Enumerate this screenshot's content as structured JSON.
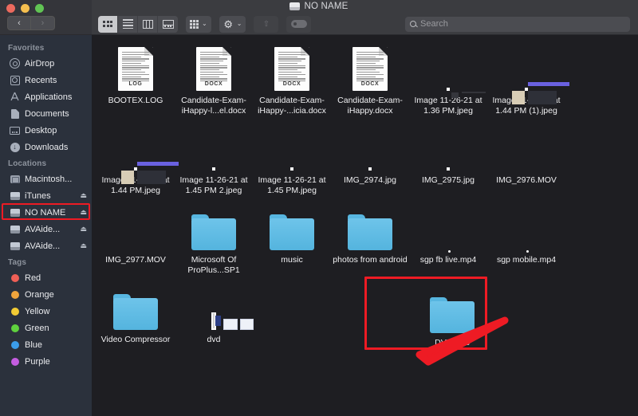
{
  "window": {
    "title": "NO NAME",
    "traffic_lights": [
      "close",
      "minimize",
      "maximize"
    ]
  },
  "toolbar": {
    "back_label": "‹",
    "forward_label": "›",
    "view_icon": "icon-view",
    "list_view": "list-view",
    "column_view": "column-view",
    "gallery_view": "gallery-view",
    "arrange_label": "arrange-button",
    "action_label": "action-gear-button",
    "share_label": "share-button",
    "tags_label": "tags-button",
    "chevron": "⌄",
    "gear_glyph": "⚙"
  },
  "search": {
    "placeholder": "Search",
    "value": ""
  },
  "sidebar": {
    "sections": [
      {
        "header": "Favorites",
        "items": [
          {
            "label": "AirDrop",
            "icon": "airdrop-icon",
            "eject": false
          },
          {
            "label": "Recents",
            "icon": "recents-icon",
            "eject": false
          },
          {
            "label": "Applications",
            "icon": "applications-icon",
            "eject": false
          },
          {
            "label": "Documents",
            "icon": "documents-icon",
            "eject": false
          },
          {
            "label": "Desktop",
            "icon": "desktop-icon",
            "eject": false
          },
          {
            "label": "Downloads",
            "icon": "downloads-icon",
            "eject": false
          }
        ]
      },
      {
        "header": "Locations",
        "items": [
          {
            "label": "Macintosh...",
            "icon": "internal-disk-icon",
            "eject": false
          },
          {
            "label": "iTunes",
            "icon": "external-drive-icon",
            "eject": true
          },
          {
            "label": "NO NAME",
            "icon": "external-drive-icon",
            "eject": true,
            "highlighted": true
          },
          {
            "label": "AVAide...",
            "icon": "external-drive-icon",
            "eject": true
          },
          {
            "label": "AVAide...",
            "icon": "external-drive-icon",
            "eject": true
          }
        ]
      },
      {
        "header": "Tags",
        "items": [
          {
            "label": "Red",
            "icon": "tag-dot-icon",
            "color": "#ef5f56"
          },
          {
            "label": "Orange",
            "icon": "tag-dot-icon",
            "color": "#f0a43c"
          },
          {
            "label": "Yellow",
            "icon": "tag-dot-icon",
            "color": "#f2cb34"
          },
          {
            "label": "Green",
            "icon": "tag-dot-icon",
            "color": "#5fd13e"
          },
          {
            "label": "Blue",
            "icon": "tag-dot-icon",
            "color": "#3b9dea"
          },
          {
            "label": "Purple",
            "icon": "tag-dot-icon",
            "color": "#c45de0"
          }
        ]
      }
    ],
    "eject_glyph": "⏏"
  },
  "files": [
    {
      "name": "BOOTEX.LOG",
      "kind": "doc",
      "ext": "LOG"
    },
    {
      "name": "Candidate-Exam-iHappy-l...el.docx",
      "kind": "doc",
      "ext": "DOCX"
    },
    {
      "name": "Candidate-Exam-iHappy-...icia.docx",
      "kind": "doc",
      "ext": "DOCX"
    },
    {
      "name": "Candidate-Exam-iHappy.docx",
      "kind": "doc",
      "ext": "DOCX"
    },
    {
      "name": "Image 11-26-21 at 1.36 PM.jpeg",
      "kind": "sshot-dark"
    },
    {
      "name": "Image 11-26-21 at 1.44 PM (1).jpeg",
      "kind": "sshot-vid"
    },
    {
      "name": "Image 11-26-21 at 1.44 PM.jpeg",
      "kind": "sshot-vid"
    },
    {
      "name": "Image 11-26-21 at 1.45 PM 2.jpeg",
      "kind": "sshot-win"
    },
    {
      "name": "Image 11-26-21 at 1.45 PM.jpeg",
      "kind": "sshot-win"
    },
    {
      "name": "IMG_2974.jpg",
      "kind": "photo-crowd"
    },
    {
      "name": "IMG_2975.jpg",
      "kind": "photo-crowd"
    },
    {
      "name": "IMG_2976.MOV",
      "kind": "photo-port"
    },
    {
      "name": "IMG_2977.MOV",
      "kind": "photo-port2"
    },
    {
      "name": "Microsoft Of ProPlus...SP1",
      "kind": "folder"
    },
    {
      "name": "music",
      "kind": "folder"
    },
    {
      "name": "photos from android",
      "kind": "folder"
    },
    {
      "name": "sgp fb live.mp4",
      "kind": "photo-night"
    },
    {
      "name": "sgp mobile.mp4",
      "kind": "photo-night"
    },
    {
      "name": "Video Compressor",
      "kind": "folder"
    },
    {
      "name": "dvd",
      "kind": "app-shot"
    }
  ],
  "highlighted_folder": {
    "name": "DVD files",
    "kind": "folder"
  },
  "annotations": {
    "box_color": "#ee1b24",
    "arrow_color": "#ee1b24",
    "arrow_points_to": "DVD files"
  }
}
